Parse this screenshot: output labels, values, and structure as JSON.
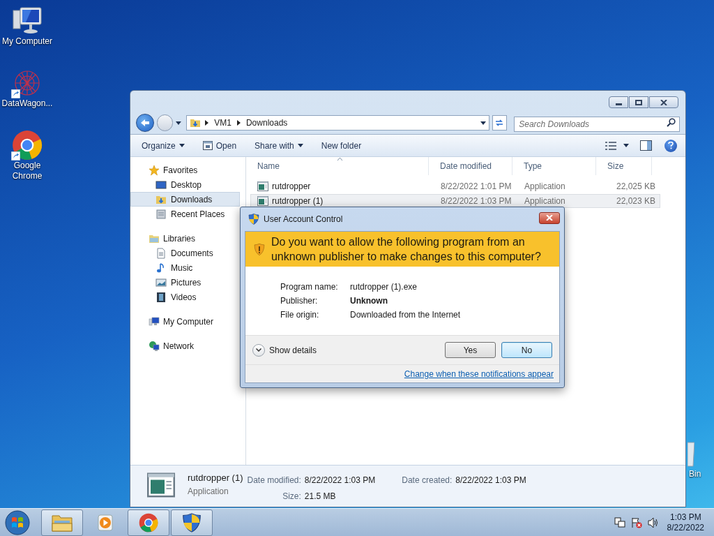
{
  "desktop_icons": [
    {
      "label": "My Computer",
      "kind": "computer",
      "shortcut": false
    },
    {
      "label": "DataWagon...",
      "kind": "app",
      "shortcut": true
    },
    {
      "label": "Google Chrome",
      "kind": "chrome",
      "shortcut": true
    }
  ],
  "recycle_bin": {
    "label": "Bin"
  },
  "explorer": {
    "breadcrumb": [
      "VM1",
      "Downloads"
    ],
    "search": {
      "placeholder": "Search Downloads"
    },
    "toolbar": [
      {
        "label": "Organize",
        "kind": "menu"
      },
      {
        "label": "Open",
        "kind": "action"
      },
      {
        "label": "Share with",
        "kind": "menu"
      },
      {
        "label": "New folder",
        "kind": "plain"
      }
    ],
    "nav": [
      {
        "label": "Favorites",
        "kind": "star",
        "children": [
          {
            "label": "Desktop",
            "kind": "desktop",
            "selected": false
          },
          {
            "label": "Downloads",
            "kind": "downloads",
            "selected": true
          },
          {
            "label": "Recent Places",
            "kind": "recent",
            "selected": false
          }
        ]
      },
      {
        "label": "Libraries",
        "kind": "libraries",
        "children": [
          {
            "label": "Documents",
            "kind": "documents",
            "selected": false
          },
          {
            "label": "Music",
            "kind": "music",
            "selected": false
          },
          {
            "label": "Pictures",
            "kind": "pictures",
            "selected": false
          },
          {
            "label": "Videos",
            "kind": "videos",
            "selected": false
          }
        ]
      },
      {
        "label": "My Computer",
        "kind": "computer"
      },
      {
        "label": "Network",
        "kind": "network"
      }
    ],
    "columns": [
      {
        "label": "Name",
        "sorted": true
      },
      {
        "label": "Date modified",
        "sorted": false
      },
      {
        "label": "Type",
        "sorted": false
      },
      {
        "label": "Size",
        "sorted": false
      }
    ],
    "rows": [
      {
        "name": "rutdropper",
        "date": "8/22/2022 1:01 PM",
        "type": "Application",
        "size": "22,025 KB",
        "selected": false
      },
      {
        "name": "rutdropper (1)",
        "date": "8/22/2022 1:03 PM",
        "type": "Application",
        "size": "22,023 KB",
        "selected": true
      }
    ],
    "details": {
      "name": "rutdropper (1)",
      "type": "Application",
      "fields": [
        {
          "label": "Date modified:",
          "value": "8/22/2022 1:03 PM"
        },
        {
          "label": "Size:",
          "value": "21.5 MB"
        },
        {
          "label": "Date created:",
          "value": "8/22/2022 1:03 PM"
        }
      ]
    }
  },
  "uac": {
    "title": "User Account Control",
    "question": "Do you want to allow the following program from an unknown publisher to make changes to this computer?",
    "properties": [
      {
        "label": "Program name:",
        "value": "rutdropper (1).exe",
        "bold": false
      },
      {
        "label": "Publisher:",
        "value": "Unknown",
        "bold": true
      },
      {
        "label": "File origin:",
        "value": "Downloaded from the Internet",
        "bold": false
      }
    ],
    "details_toggle": "Show details",
    "buttons": [
      {
        "label": "Yes",
        "default": false
      },
      {
        "label": "No",
        "default": true
      }
    ],
    "link": "Change when these notifications appear"
  },
  "taskbar": {
    "items": [
      {
        "kind": "explorer",
        "running": true
      },
      {
        "kind": "media",
        "running": false
      },
      {
        "kind": "chrome",
        "running": true
      },
      {
        "kind": "shield",
        "running": true
      }
    ],
    "clock": {
      "time": "1:03 PM",
      "date": "8/22/2022"
    }
  }
}
